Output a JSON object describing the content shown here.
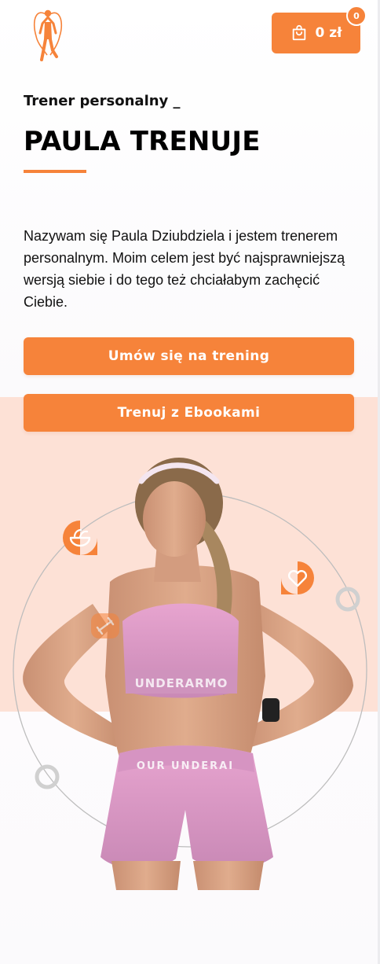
{
  "header": {
    "logo": "jump-rope-person-logo",
    "cart": {
      "total": "0 zł",
      "count": "0",
      "icon": "shopping-bag-icon"
    }
  },
  "hero": {
    "subtitle": "Trener personalny _",
    "title": "PAULA TRENUJE",
    "intro": "Nazywam się Paula Dziubdziela i jestem trenerem personalnym. Moim celem jest być najsprawniejszą wersją siebie i do tego też chciałabym zachęcić Ciebie.",
    "buttons": {
      "book_training": "Umów się na trening",
      "ebooks": "Trenuj z Ebookami"
    }
  },
  "illustration": {
    "photo": "trainer-portrait",
    "shorts_print": "OUR UNDERAI",
    "top_print": "UNDERARMO",
    "badges": [
      "salad-bowl-icon",
      "heart-icon",
      "dumbbell-icon"
    ]
  },
  "colors": {
    "accent": "#f6833a",
    "peach": "#fde1d6",
    "text": "#111111"
  }
}
